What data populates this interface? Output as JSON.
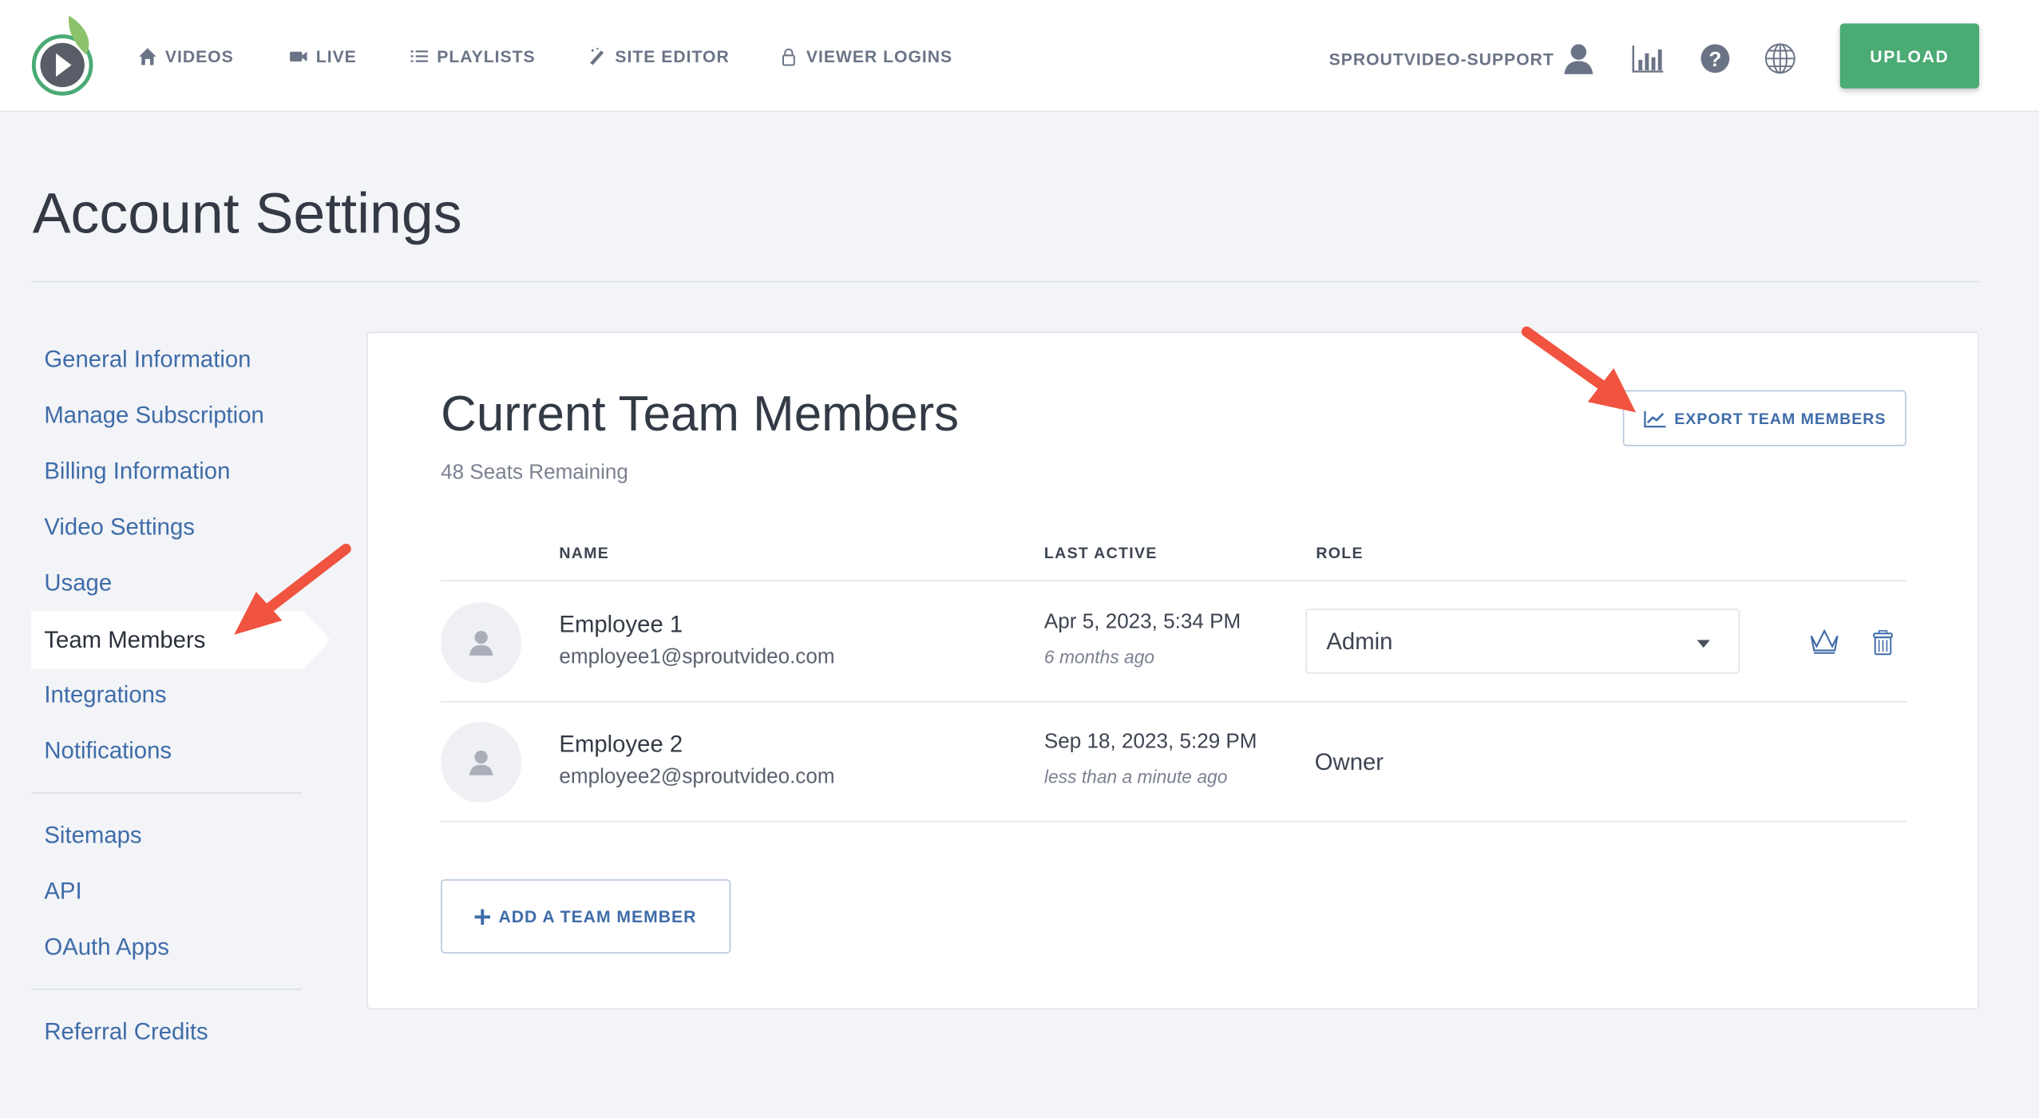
{
  "header": {
    "nav": [
      {
        "label": "VIDEOS",
        "icon": "home-icon"
      },
      {
        "label": "LIVE",
        "icon": "video-camera-icon"
      },
      {
        "label": "PLAYLISTS",
        "icon": "list-icon"
      },
      {
        "label": "SITE EDITOR",
        "icon": "magic-wand-icon"
      },
      {
        "label": "VIEWER LOGINS",
        "icon": "lock-icon"
      }
    ],
    "username": "SPROUTVIDEO-SUPPORT",
    "upload_label": "UPLOAD",
    "upload_color": "#4aab74"
  },
  "page_title": "Account Settings",
  "sidebar": {
    "items": [
      {
        "label": "General Information"
      },
      {
        "label": "Manage Subscription"
      },
      {
        "label": "Billing Information"
      },
      {
        "label": "Video Settings"
      },
      {
        "label": "Usage"
      },
      {
        "label": "Team Members",
        "active": true
      },
      {
        "label": "Integrations"
      },
      {
        "label": "Notifications"
      },
      {
        "label": "Sitemaps"
      },
      {
        "label": "API"
      },
      {
        "label": "OAuth Apps"
      },
      {
        "label": "Referral Credits"
      }
    ]
  },
  "team": {
    "title": "Current Team Members",
    "seats": "48 Seats Remaining",
    "export_label": "EXPORT TEAM MEMBERS",
    "columns": [
      "NAME",
      "LAST ACTIVE",
      "ROLE"
    ],
    "members": [
      {
        "name": "Employee 1",
        "email": "employee1@sproutvideo.com",
        "date": "Apr 5, 2023, 5:34 PM",
        "ago": "6 months ago",
        "role": "Admin"
      },
      {
        "name": "Employee 2",
        "email": "employee2@sproutvideo.com",
        "date": "Sep 18, 2023, 5:29 PM",
        "ago": "less than a minute ago",
        "role": "Owner"
      }
    ],
    "add_label": "ADD A TEAM MEMBER"
  },
  "colors": {
    "accent": "#3f6ca8",
    "annotation_arrow": "#f0533f"
  }
}
